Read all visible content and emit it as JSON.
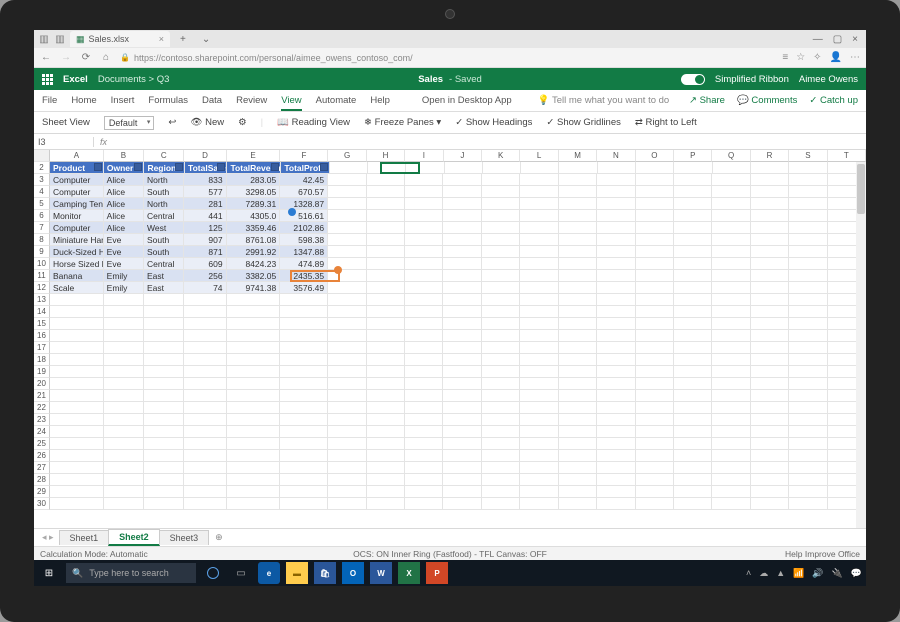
{
  "browser": {
    "tab_title": "Sales.xlsx",
    "url": "https://contoso.sharepoint.com/personal/aimee_owens_contoso_com/"
  },
  "titlebar": {
    "app": "Excel",
    "breadcrumb": "Documents > Q3",
    "doc": "Sales",
    "saved": "- Saved",
    "simplified": "Simplified Ribbon",
    "user": "Aimee Owens"
  },
  "ribbon": {
    "tabs": [
      "File",
      "Home",
      "Insert",
      "Formulas",
      "Data",
      "Review",
      "View",
      "Automate",
      "Help"
    ],
    "open_desktop": "Open in Desktop App",
    "tellme": "Tell me what you want to do",
    "share": "Share",
    "comments": "Comments",
    "catchup": "Catch up",
    "sheet_view_label": "Sheet View",
    "sheet_view_value": "Default",
    "new_btn": "New",
    "reading": "Reading View",
    "freeze": "Freeze Panes",
    "headings": "Show Headings",
    "gridlines": "Show Gridlines",
    "rtl": "Right to Left"
  },
  "namebox": "I3",
  "columns": [
    "A",
    "B",
    "C",
    "D",
    "E",
    "F",
    "G",
    "H",
    "I",
    "J",
    "K",
    "L",
    "M",
    "N",
    "O",
    "P",
    "Q",
    "R",
    "S",
    "T"
  ],
  "col_widths": {
    "A": 56,
    "B": 42,
    "C": 42,
    "D": 44,
    "E": 56,
    "F": 50,
    "rest": 40
  },
  "table": {
    "headers": [
      "Product",
      "Owner",
      "Region",
      "TotalSales",
      "TotalRevenue",
      "TotalProfit"
    ],
    "rows": [
      {
        "n": 3,
        "c": [
          "Computer",
          "Alice",
          "North",
          "833",
          "283.05",
          "42.45"
        ]
      },
      {
        "n": 4,
        "c": [
          "Computer",
          "Alice",
          "South",
          "577",
          "3298.05",
          "670.57"
        ]
      },
      {
        "n": 5,
        "c": [
          "Camping Tent",
          "Alice",
          "North",
          "281",
          "7289.31",
          "1328.87"
        ]
      },
      {
        "n": 6,
        "c": [
          "Monitor",
          "Alice",
          "Central",
          "441",
          "4305.0",
          "516.61"
        ]
      },
      {
        "n": 7,
        "c": [
          "Computer",
          "Alice",
          "West",
          "125",
          "3359.46",
          "2102.86"
        ]
      },
      {
        "n": 8,
        "c": [
          "Miniature Hamster",
          "Eve",
          "South",
          "907",
          "8761.08",
          "598.38"
        ]
      },
      {
        "n": 9,
        "c": [
          "Duck-Sized Horse",
          "Eve",
          "South",
          "871",
          "2991.92",
          "1347.88"
        ]
      },
      {
        "n": 10,
        "c": [
          "Horse Sized Duck",
          "Eve",
          "Central",
          "609",
          "8424.23",
          "474.89"
        ]
      },
      {
        "n": 11,
        "c": [
          "Banana",
          "Emily",
          "East",
          "256",
          "3382.05",
          "2435.35"
        ]
      },
      {
        "n": 12,
        "c": [
          "Scale",
          "Emily",
          "East",
          "74",
          "9741.38",
          "3576.49"
        ]
      }
    ]
  },
  "sheets": [
    "Sheet1",
    "Sheet2",
    "Sheet3"
  ],
  "active_sheet": 1,
  "status": {
    "left": "Calculation Mode: Automatic",
    "mid": "OCS: ON    Inner Ring (Fastfood) - TFL    Canvas: OFF",
    "right": "Help Improve Office"
  },
  "taskbar": {
    "search": "Type here to search",
    "time": ""
  }
}
